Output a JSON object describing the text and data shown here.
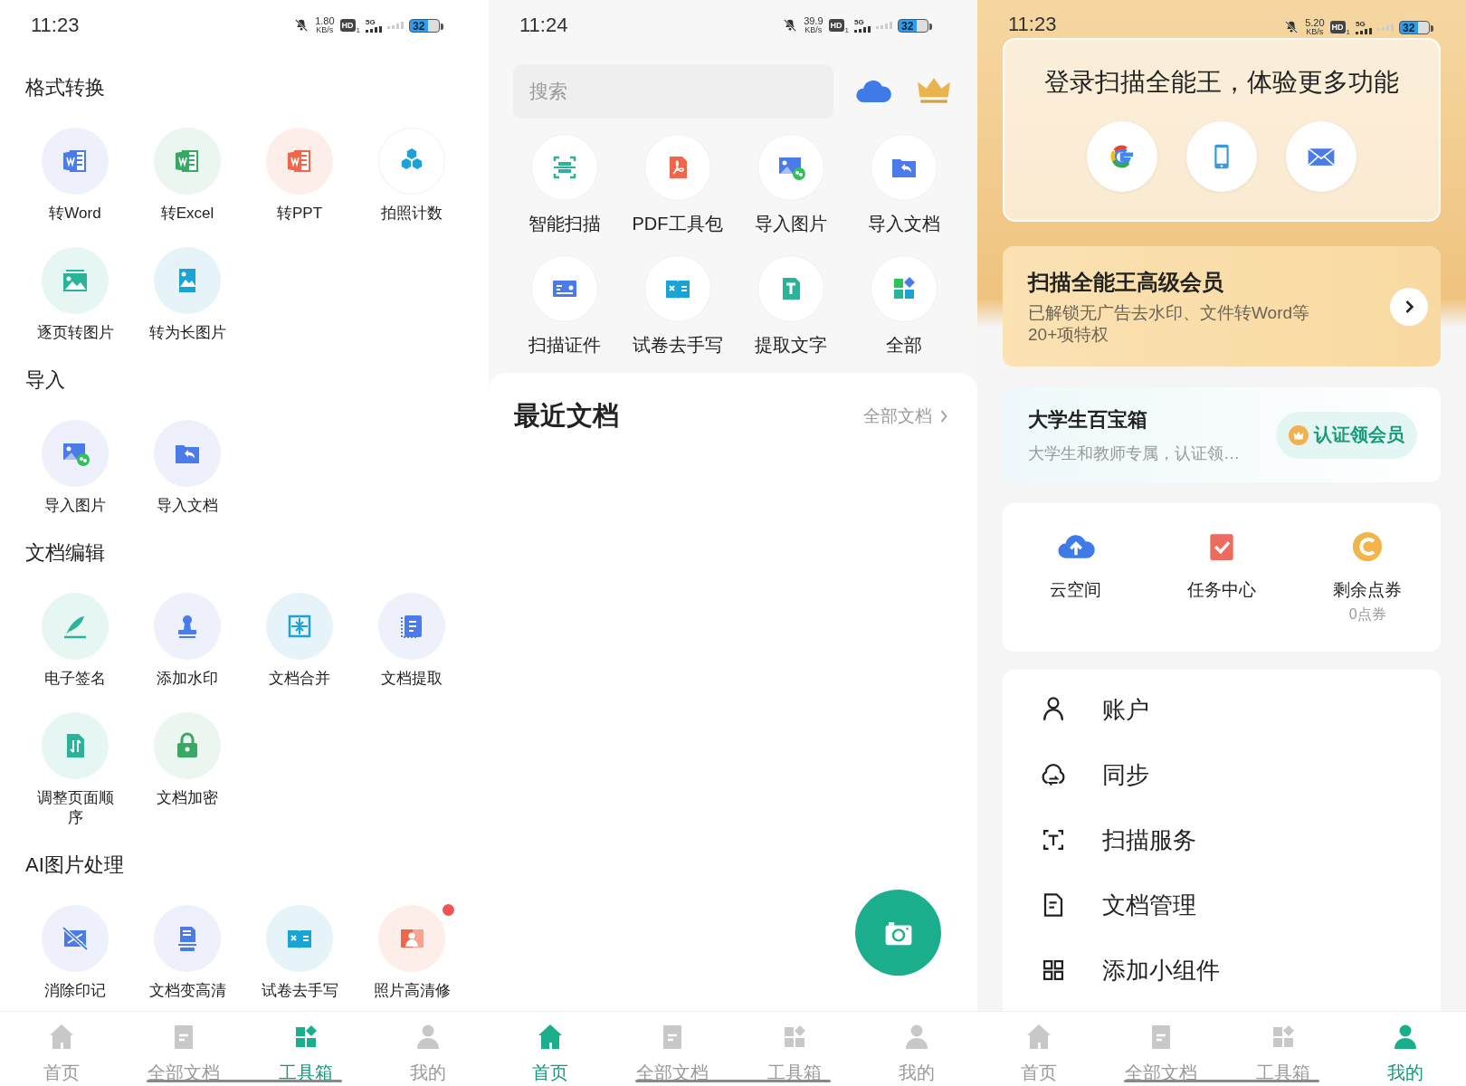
{
  "screens": [
    {
      "kind": "tools",
      "status_bar": {
        "time": "11:23",
        "speed": "1.80",
        "speed_unit": "KB/s",
        "hd": "HD",
        "sim": "1",
        "network": "5G",
        "battery": "32"
      },
      "sections": [
        {
          "title": "格式转换",
          "tools": [
            {
              "label": "转Word",
              "new_dot": false
            },
            {
              "label": "转Excel",
              "new_dot": false
            },
            {
              "label": "转PPT",
              "new_dot": false
            },
            {
              "label": "拍照计数",
              "new_dot": false
            },
            {
              "label": "逐页转图片",
              "new_dot": false
            },
            {
              "label": "转为长图片",
              "new_dot": false
            }
          ]
        },
        {
          "title": "导入",
          "tools": [
            {
              "label": "导入图片",
              "new_dot": false
            },
            {
              "label": "导入文档",
              "new_dot": false
            }
          ]
        },
        {
          "title": "文档编辑",
          "tools": [
            {
              "label": "电子签名",
              "new_dot": false
            },
            {
              "label": "添加水印",
              "new_dot": false
            },
            {
              "label": "文档合并",
              "new_dot": false
            },
            {
              "label": "文档提取",
              "new_dot": false
            },
            {
              "label": "调整页面顺序",
              "new_dot": false
            },
            {
              "label": "文档加密",
              "new_dot": false
            }
          ]
        },
        {
          "title": "AI图片处理",
          "tools": [
            {
              "label": "消除印记",
              "new_dot": false
            },
            {
              "label": "文档变高清",
              "new_dot": false
            },
            {
              "label": "试卷去手写",
              "new_dot": false
            },
            {
              "label": "照片高清修",
              "new_dot": true
            }
          ]
        }
      ],
      "tab_bar": [
        {
          "label": "首页",
          "selected": false
        },
        {
          "label": "全部文档",
          "selected": false
        },
        {
          "label": "工具箱",
          "selected": true
        },
        {
          "label": "我的",
          "selected": false
        }
      ]
    },
    {
      "kind": "home",
      "status_bar": {
        "time": "11:24",
        "speed": "39.9",
        "speed_unit": "KB/s",
        "hd": "HD",
        "sim": "1",
        "network": "5G",
        "battery": "32"
      },
      "search": {
        "placeholder": "搜索"
      },
      "shortcuts": [
        {
          "label": "智能扫描"
        },
        {
          "label": "PDF工具包"
        },
        {
          "label": "导入图片"
        },
        {
          "label": "导入文档"
        },
        {
          "label": "扫描证件"
        },
        {
          "label": "试卷去手写"
        },
        {
          "label": "提取文字"
        },
        {
          "label": "全部"
        }
      ],
      "recent": {
        "title": "最近文档",
        "link": "全部文档"
      },
      "tab_bar": [
        {
          "label": "首页",
          "selected": true
        },
        {
          "label": "全部文档",
          "selected": false
        },
        {
          "label": "工具箱",
          "selected": false
        },
        {
          "label": "我的",
          "selected": false
        }
      ]
    },
    {
      "kind": "me",
      "status_bar": {
        "time": "11:23",
        "speed": "5.20",
        "speed_unit": "KB/s",
        "hd": "HD",
        "sim": "1",
        "network": "5G",
        "battery": "32"
      },
      "login": {
        "title": "登录扫描全能王，体验更多功能"
      },
      "vip": {
        "title": "扫描全能王高级会员",
        "description": "已解锁无广告去水印、文件转Word等20+项特权"
      },
      "student": {
        "title": "大学生百宝箱",
        "description": "大学生和教师专属，认证领…",
        "button": "认证领会员"
      },
      "stats": [
        {
          "label": "云空间"
        },
        {
          "label": "任务中心"
        },
        {
          "label": "剩余点券",
          "sub": "0点券"
        }
      ],
      "menu": [
        {
          "label": "账户"
        },
        {
          "label": "同步"
        },
        {
          "label": "扫描服务"
        },
        {
          "label": "文档管理"
        },
        {
          "label": "添加小组件"
        }
      ],
      "tab_bar": [
        {
          "label": "首页",
          "selected": false
        },
        {
          "label": "全部文档",
          "selected": false
        },
        {
          "label": "工具箱",
          "selected": false
        },
        {
          "label": "我的",
          "selected": true
        }
      ]
    }
  ]
}
